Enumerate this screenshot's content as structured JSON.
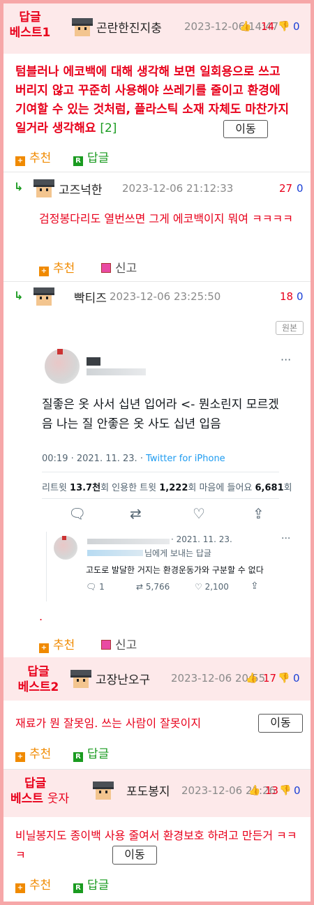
{
  "best1": {
    "label_line1": "답글",
    "label_line2": "베스트1",
    "nick": "곤란한진지충",
    "date": "2023-12-06 14:47",
    "rec": "14",
    "nrec": "0",
    "content": "텀블러나 에코백에 대해 생각해 보면 일회용으로 쓰고 버리지 않고 꾸준히 사용해야 쓰레기를 줄이고 환경에 기여할 수 있는 것처럼, 플라스틱 소재 자체도 마찬가지일거라 생각해요",
    "reply_count": "[2]",
    "move": "이동",
    "recommend": "추천",
    "reply": "답글"
  },
  "reply1": {
    "nick": "고즈넉한",
    "date": "2023-12-06 21:12:33",
    "rec": "27",
    "nrec": "0",
    "content": "검정봉다리도 열번쓰면 그게 에코백이지 뭐여 ㅋㅋㅋㅋ",
    "recommend": "추천",
    "report": "신고"
  },
  "reply2": {
    "nick": "빡티즈",
    "date": "2023-12-06 23:25:50",
    "rec": "18",
    "nrec": "0",
    "original_btn": "원본",
    "tweet": {
      "menu": "···",
      "text": "질좋은 옷 사서 십년 입어라 <- 뭔소린지 모르겠음 나는 질 안좋은 옷 사도 십년 입음",
      "time": "00:19 · 2021. 11. 23. · ",
      "source": "Twitter for iPhone",
      "retweets_label": "리트윗",
      "retweets": "13.7천",
      "quotes_label": "회 인용한 트윗",
      "quotes": "1,222",
      "likes_label": "회 마음에 들어요",
      "likes": "6,681",
      "likes_suffix": "회",
      "quote_date": "· 2021. 11. 23.",
      "quote_reply_to": "님에게 보내는 답글",
      "quote_text": "고도로 발달한 거지는 환경운동가와 구분할 수 없다",
      "q_replies": "1",
      "q_retweets": "5,766",
      "q_likes": "2,100"
    },
    "trailing": ".",
    "recommend": "추천",
    "report": "신고"
  },
  "best2": {
    "label_line1": "답글",
    "label_line2": "베스트2",
    "nick": "고장난오구",
    "date": "2023-12-06 20:55",
    "rec": "17",
    "nrec": "0",
    "content": "재료가 뭔 잘못임. 쓰는 사람이 잘못이지",
    "move": "이동",
    "recommend": "추천",
    "reply": "답글"
  },
  "best3": {
    "label_line1": "답글",
    "label_line2": "베스트",
    "label_sub": "웃자",
    "nick": "포도봉지",
    "date": "2023-12-06 21:26",
    "rec": "13",
    "nrec": "0",
    "content": "비닐봉지도 종이백 사용 줄여서 환경보호 하려고 만든거 ㅋㅋㅋ",
    "move": "이동",
    "recommend": "추천",
    "reply": "답글"
  }
}
